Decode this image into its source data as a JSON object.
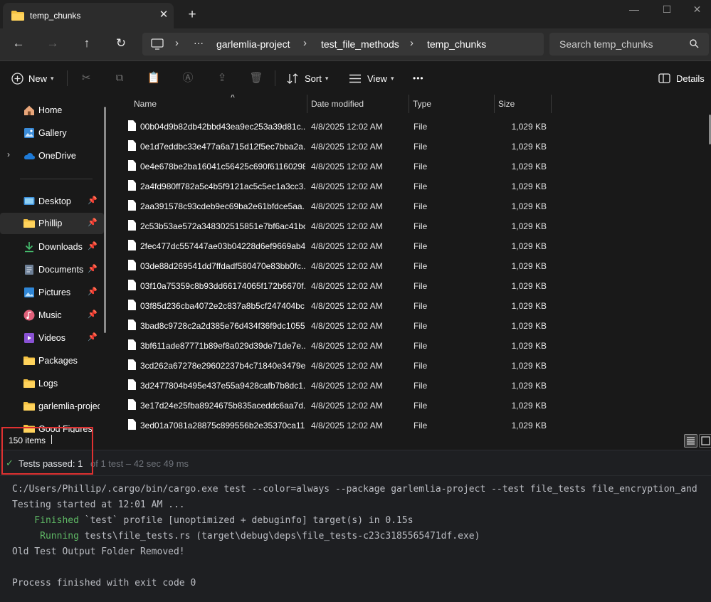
{
  "window": {
    "tab_title": "temp_chunks",
    "close_glyph": "✕",
    "new_tab_glyph": "+",
    "minimize_glyph": "—",
    "maximize_glyph": "☐",
    "close_window_glyph": "✕"
  },
  "nav": {
    "back": "←",
    "forward": "→",
    "up": "↑",
    "refresh": "↻",
    "breadcrumb": [
      "garlemlia-project",
      "test_file_methods",
      "temp_chunks"
    ],
    "ellipsis": "···",
    "sep": "›",
    "search_placeholder": "Search temp_chunks"
  },
  "toolbar": {
    "new_label": "New",
    "sort_label": "Sort",
    "view_label": "View",
    "more": "•••",
    "details_label": "Details"
  },
  "sidebar": {
    "top": [
      {
        "label": "Home",
        "icon": "home-icon"
      },
      {
        "label": "Gallery",
        "icon": "gallery-icon"
      },
      {
        "label": "OneDrive",
        "icon": "onedrive-icon"
      }
    ],
    "quick": [
      {
        "label": "Desktop",
        "icon": "desktop-icon",
        "pinned": true
      },
      {
        "label": "Phillip",
        "icon": "folder-icon",
        "pinned": true,
        "selected": true
      },
      {
        "label": "Downloads",
        "icon": "download-icon",
        "pinned": true
      },
      {
        "label": "Documents",
        "icon": "documents-icon",
        "pinned": true
      },
      {
        "label": "Pictures",
        "icon": "pictures-icon",
        "pinned": true
      },
      {
        "label": "Music",
        "icon": "music-icon",
        "pinned": true
      },
      {
        "label": "Videos",
        "icon": "videos-icon",
        "pinned": true
      },
      {
        "label": "Packages",
        "icon": "folder-icon",
        "pinned": false
      },
      {
        "label": "Logs",
        "icon": "folder-icon",
        "pinned": false
      },
      {
        "label": "garlemlia-project",
        "icon": "folder-icon",
        "pinned": false
      },
      {
        "label": "Good Figures",
        "icon": "folder-icon",
        "pinned": false
      }
    ],
    "pin_glyph": "📌",
    "chevron": "›"
  },
  "columns": {
    "name": "Name",
    "date": "Date modified",
    "type": "Type",
    "size": "Size"
  },
  "files": [
    {
      "name": "00b04d9b82db42bbd43ea9ec253a39d81c...",
      "date": "4/8/2025 12:02 AM",
      "type": "File",
      "size": "1,029 KB"
    },
    {
      "name": "0e1d7eddbc33e477a6a715d12f5ec7bba2a...",
      "date": "4/8/2025 12:02 AM",
      "type": "File",
      "size": "1,029 KB"
    },
    {
      "name": "0e4e678be2ba16041c56425c690f61160298...",
      "date": "4/8/2025 12:02 AM",
      "type": "File",
      "size": "1,029 KB"
    },
    {
      "name": "2a4fd980ff782a5c4b5f9121ac5c5ec1a3cc3...",
      "date": "4/8/2025 12:02 AM",
      "type": "File",
      "size": "1,029 KB"
    },
    {
      "name": "2aa391578c93cdeb9ec69ba2e61bfdce5aa...",
      "date": "4/8/2025 12:02 AM",
      "type": "File",
      "size": "1,029 KB"
    },
    {
      "name": "2c53b53ae572a348302515851e7bf6ac41bc...",
      "date": "4/8/2025 12:02 AM",
      "type": "File",
      "size": "1,029 KB"
    },
    {
      "name": "2fec477dc557447ae03b04228d6ef9669ab4...",
      "date": "4/8/2025 12:02 AM",
      "type": "File",
      "size": "1,029 KB"
    },
    {
      "name": "03de88d269541dd7ffdadf580470e83bb0fc...",
      "date": "4/8/2025 12:02 AM",
      "type": "File",
      "size": "1,029 KB"
    },
    {
      "name": "03f10a75359c8b93dd66174065f172b6670f...",
      "date": "4/8/2025 12:02 AM",
      "type": "File",
      "size": "1,029 KB"
    },
    {
      "name": "03f85d236cba4072e2c837a8b5cf247404bc...",
      "date": "4/8/2025 12:02 AM",
      "type": "File",
      "size": "1,029 KB"
    },
    {
      "name": "3bad8c9728c2a2d385e76d434f36f9dc1055...",
      "date": "4/8/2025 12:02 AM",
      "type": "File",
      "size": "1,029 KB"
    },
    {
      "name": "3bf611ade87771b89ef8a029d39de71de7e...",
      "date": "4/8/2025 12:02 AM",
      "type": "File",
      "size": "1,029 KB"
    },
    {
      "name": "3cd262a67278e29602237b4c71840e3479e...",
      "date": "4/8/2025 12:02 AM",
      "type": "File",
      "size": "1,029 KB"
    },
    {
      "name": "3d2477804b495e437e55a9428cafb7b8dc1...",
      "date": "4/8/2025 12:02 AM",
      "type": "File",
      "size": "1,029 KB"
    },
    {
      "name": "3e17d24e25fba8924675b835aceddc6aa7d...",
      "date": "4/8/2025 12:02 AM",
      "type": "File",
      "size": "1,029 KB"
    },
    {
      "name": "3ed01a7081a28875c899556b2e35370ca11...",
      "date": "4/8/2025 12:02 AM",
      "type": "File",
      "size": "1,029 KB"
    }
  ],
  "status": {
    "item_count": "150 items"
  },
  "run": {
    "check": "✓",
    "tests_passed": "Tests passed: 1",
    "tests_detail": "of 1 test – 42 sec 49 ms",
    "console": [
      {
        "text": "C:/Users/Phillip/.cargo/bin/cargo.exe test --color=always --package garlemlia-project --test file_tests file_encryption_and",
        "kw": ""
      },
      {
        "text": "Testing started at 12:01 AM ...",
        "kw": ""
      },
      {
        "text": " `test` profile [unoptimized + debuginfo] target(s) in 0.15s",
        "kw": "    Finished"
      },
      {
        "text": " tests\\file_tests.rs (target\\debug\\deps\\file_tests-c23c3185565471df.exe)",
        "kw": "     Running"
      },
      {
        "text": "Old Test Output Folder Removed!",
        "kw": ""
      },
      {
        "text": "",
        "kw": ""
      },
      {
        "text": "Process finished with exit code 0",
        "kw": ""
      }
    ]
  },
  "colors": {
    "accent_folder": "#f4c242",
    "pass_green": "#5fb865",
    "highlight_red": "#e03131"
  }
}
